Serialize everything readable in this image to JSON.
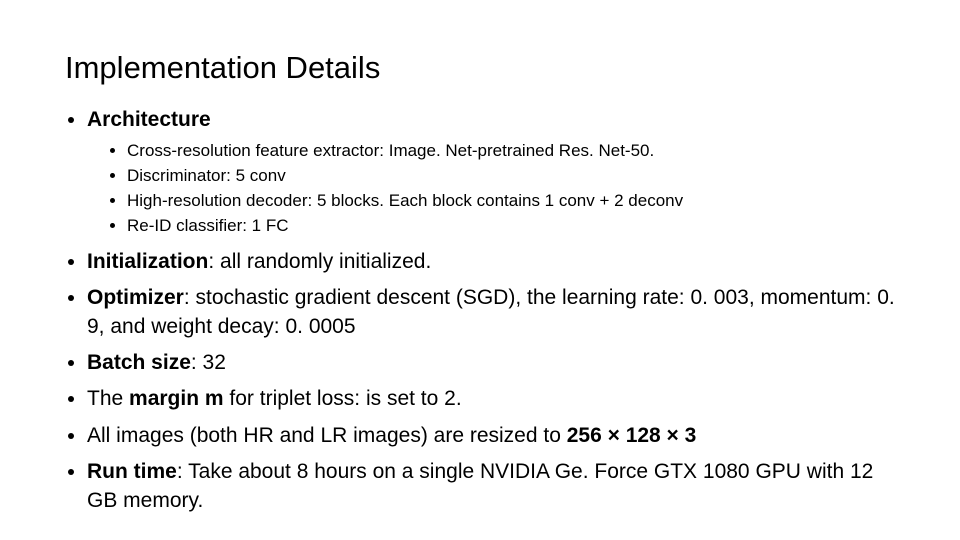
{
  "title": "Implementation Details",
  "arch": {
    "heading": "Architecture",
    "items": [
      "Cross-resolution feature extractor: Image. Net-pretrained Res. Net-50.",
      "Discriminator: 5 conv",
      "High-resolution decoder: 5 blocks. Each block contains 1 conv + 2 deconv",
      "Re-ID classifier: 1 FC"
    ]
  },
  "init": {
    "label": "Initialization",
    "rest": ": all randomly initialized."
  },
  "opt": {
    "label": "Optimizer",
    "rest": ": stochastic gradient descent (SGD), the learning rate: 0. 003, momentum: 0. 9, and weight decay: 0. 0005"
  },
  "batch": {
    "label": "Batch size",
    "rest": ": 32"
  },
  "margin": {
    "pre": "The ",
    "label": "margin m",
    "rest": " for triplet loss: is set to 2."
  },
  "resize": {
    "pre": "All images (both HR and LR images) are resized to ",
    "label": "256 × 128 × 3"
  },
  "runtime": {
    "label": "Run time",
    "rest": ": Take about 8 hours on a single NVIDIA Ge. Force GTX 1080 GPU with 12 GB memory."
  }
}
